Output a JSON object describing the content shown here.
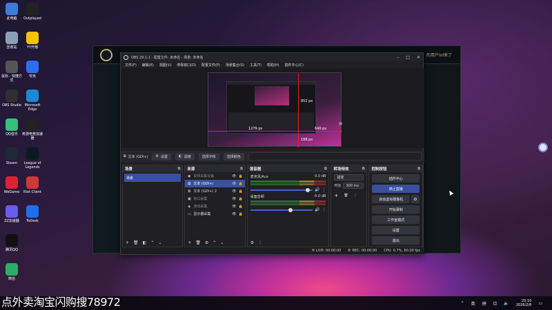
{
  "desktop": {
    "icons_left": [
      {
        "label": "此电脑",
        "icon": "computer-icon",
        "color": "#3b7dd8"
      },
      {
        "label": "回收站",
        "icon": "recycle-bin-icon",
        "color": "#8aa0b8"
      },
      {
        "label": "鼠标 - 快捷方式",
        "icon": "mouse-icon",
        "color": "#555"
      },
      {
        "label": "OBS Studio",
        "icon": "obs-icon",
        "color": "#302e31"
      },
      {
        "label": "QQ音乐",
        "icon": "qqmusic-icon",
        "color": "#31c27c"
      },
      {
        "label": "Steam",
        "icon": "steam-icon",
        "color": "#1b2838"
      },
      {
        "label": "WeGame",
        "icon": "wegame-icon",
        "color": "#d23"
      },
      {
        "label": "ZZ加速器",
        "icon": "zz-icon",
        "color": "#6a5cf0"
      },
      {
        "label": "腾讯QQ",
        "icon": "qq-icon",
        "color": "#111"
      },
      {
        "label": "微信",
        "icon": "wechat-icon",
        "color": "#2aae67"
      }
    ],
    "icons_right": [
      {
        "label": "Outplayed",
        "icon": "outplayed-icon",
        "color": "#222"
      },
      {
        "label": "YY开播",
        "icon": "yy-icon",
        "color": "#f5c400"
      },
      {
        "label": "夸克",
        "icon": "quark-icon",
        "color": "#2d6ef0"
      },
      {
        "label": "Microsoft Edge",
        "icon": "edge-icon",
        "color": "#1a8ad8"
      },
      {
        "label": "奇游电竞加速器",
        "icon": "qiyou-icon",
        "color": "#222"
      },
      {
        "label": "League of Legends",
        "icon": "lol-icon",
        "color": "#0b1a22"
      },
      {
        "label": "Riot Client",
        "icon": "riot-icon",
        "color": "#d13639"
      },
      {
        "label": "ToDesk",
        "icon": "todesk-icon",
        "color": "#1e6ff0"
      }
    ]
  },
  "game": {
    "right_text": "的用户lol来了"
  },
  "obs": {
    "title": "OBS 29.1.1 - 配置文件: 未命名 - 场景: 未命名",
    "menu": [
      "文件(F)",
      "编辑(E)",
      "视图(V)",
      "停靠窗口(D)",
      "配置文件(P)",
      "场景集合(S)",
      "工具(T)",
      "帮助(H)",
      "插件中心(C)"
    ],
    "preview": {
      "labels": {
        "top": "852 px",
        "left": "1279 px",
        "right": "640 px",
        "bottom": "188 px"
      }
    },
    "source_toolbar": {
      "source_name": "文本 (GDI+)",
      "settings": "设置",
      "filters": "滤镜",
      "select_font": "选择字体",
      "select_color": "选择颜色"
    },
    "docks": {
      "scenes": {
        "title": "场景",
        "items": [
          "场景"
        ]
      },
      "sources": {
        "title": "来源",
        "items": [
          {
            "name": "视频采集设备",
            "icon": "camera-icon",
            "selected": false,
            "dim": true
          },
          {
            "name": "文本 (GDI+)",
            "icon": "text-icon",
            "selected": true,
            "dim": false
          },
          {
            "name": "文本 (GDI+) 2",
            "icon": "text-icon",
            "selected": false,
            "dim": false
          },
          {
            "name": "窗口采集",
            "icon": "window-icon",
            "selected": false,
            "dim": true
          },
          {
            "name": "游戏采集",
            "icon": "gamepad-icon",
            "selected": false,
            "dim": true
          },
          {
            "name": "显示器采集",
            "icon": "monitor-icon",
            "selected": false,
            "dim": false
          }
        ]
      },
      "mixer": {
        "title": "混音器",
        "channels": [
          {
            "name": "麦克风/Aux",
            "db": "0.0 dB",
            "level": 0.92
          },
          {
            "name": "桌面音频",
            "db": "-5.0 dB",
            "level": 0.65
          }
        ]
      },
      "transitions": {
        "title": "转场特效",
        "type": "褪变",
        "duration_label": "时长",
        "duration": "300 ms"
      },
      "controls": {
        "title": "控制按钮",
        "buttons": [
          "插件中心",
          "停止直播",
          "启动虚拟摄像机",
          "开始录制",
          "工作室模式",
          "设置",
          "退出"
        ]
      }
    },
    "status": {
      "live": "LIVE: 00:00:00",
      "rec": "REC: 00:00:00",
      "cpu": "CPU: 0.7%, 60.00 fps"
    }
  },
  "taskbar": {
    "ime": "英",
    "ime2": "拼",
    "time": "20:10",
    "date": "2026/2/8"
  },
  "watermark": "点外卖淘宝闪购搜78972"
}
